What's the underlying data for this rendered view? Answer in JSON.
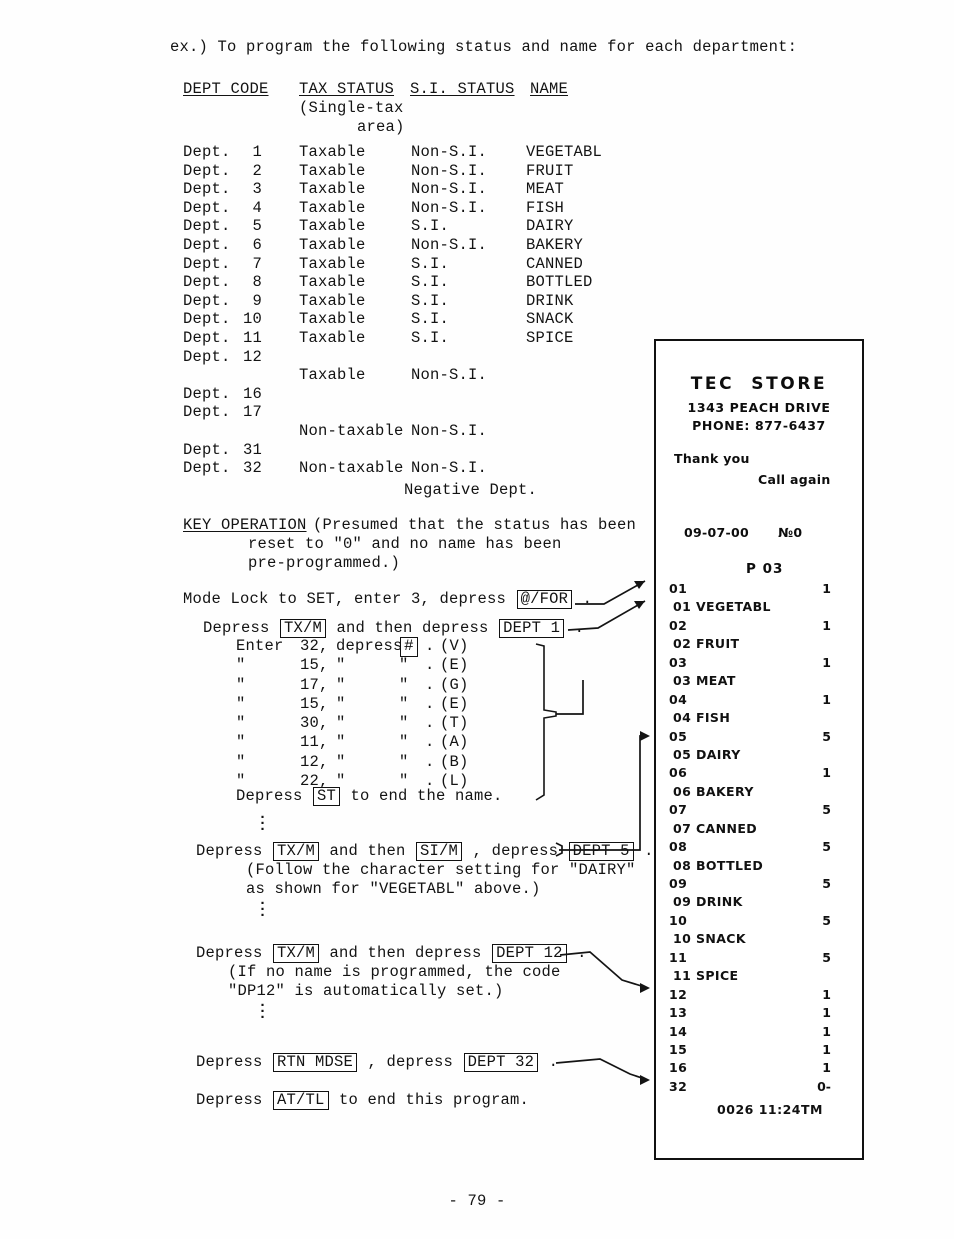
{
  "intro": "ex.) To program the following status and name for each department:",
  "table": {
    "headers": {
      "dept_code": "DEPT CODE",
      "tax_status": "TAX STATUS",
      "si_status": "S.I. STATUS",
      "name": "NAME",
      "tax_sub_1": "(Single-tax",
      "tax_sub_2": "area)"
    },
    "rows": [
      {
        "code_label": "Dept.",
        "code_num": "1",
        "tax": "Taxable",
        "si": "Non-S.I.",
        "name": "VEGETABL"
      },
      {
        "code_label": "Dept.",
        "code_num": "2",
        "tax": "Taxable",
        "si": "Non-S.I.",
        "name": "FRUIT"
      },
      {
        "code_label": "Dept.",
        "code_num": "3",
        "tax": "Taxable",
        "si": "Non-S.I.",
        "name": "MEAT"
      },
      {
        "code_label": "Dept.",
        "code_num": "4",
        "tax": "Taxable",
        "si": "Non-S.I.",
        "name": "FISH"
      },
      {
        "code_label": "Dept.",
        "code_num": "5",
        "tax": "Taxable",
        "si": "S.I.",
        "name": "DAIRY"
      },
      {
        "code_label": "Dept.",
        "code_num": "6",
        "tax": "Taxable",
        "si": "Non-S.I.",
        "name": "BAKERY"
      },
      {
        "code_label": "Dept.",
        "code_num": "7",
        "tax": "Taxable",
        "si": "S.I.",
        "name": "CANNED"
      },
      {
        "code_label": "Dept.",
        "code_num": "8",
        "tax": "Taxable",
        "si": "S.I.",
        "name": "BOTTLED"
      },
      {
        "code_label": "Dept.",
        "code_num": "9",
        "tax": "Taxable",
        "si": "S.I.",
        "name": "DRINK"
      },
      {
        "code_label": "Dept.",
        "code_num": "10",
        "tax": "Taxable",
        "si": "S.I.",
        "name": "SNACK"
      },
      {
        "code_label": "Dept.",
        "code_num": "11",
        "tax": "Taxable",
        "si": "S.I.",
        "name": "SPICE"
      },
      {
        "code_label": "Dept.",
        "code_num": "12",
        "tax": "",
        "si": "",
        "name": ""
      },
      {
        "code_label": "",
        "code_num": "",
        "tax": "Taxable",
        "si": "Non-S.I.",
        "name": ""
      },
      {
        "code_label": "Dept.",
        "code_num": "16",
        "tax": "",
        "si": "",
        "name": ""
      },
      {
        "code_label": "Dept.",
        "code_num": "17",
        "tax": "",
        "si": "",
        "name": ""
      },
      {
        "code_label": "",
        "code_num": "",
        "tax": "Non-taxable",
        "si": "Non-S.I.",
        "name": ""
      },
      {
        "code_label": "Dept.",
        "code_num": "31",
        "tax": "",
        "si": "",
        "name": ""
      },
      {
        "code_label": "Dept.",
        "code_num": "32",
        "tax": "Non-taxable",
        "si": "Non-S.I.",
        "name": ""
      }
    ],
    "negative_dept": "Negative Dept."
  },
  "key_operation": {
    "title": "KEY OPERATION",
    "note_line1": "(Presumed that the status has been",
    "note_line2": "reset to \"0\" and no name has been",
    "note_line3": "pre-programmed.)",
    "mode_lock": {
      "pre": "Mode Lock to SET, enter 3, depress ",
      "key": "@/FOR",
      "post": " ."
    },
    "dept1": {
      "pre": "Depress ",
      "key1": "TX/M",
      "mid": " and then depress ",
      "key2": "DEPT 1",
      "post": " ."
    },
    "char_entry": [
      {
        "lead": "Enter",
        "num": "32,",
        "c2": "depress",
        "ditto": "#",
        "dot": ".",
        "ch": "(V)",
        "key": true
      },
      {
        "lead": "\"",
        "num": "15,",
        "c2": "\"",
        "ditto": "\"",
        "dot": ".",
        "ch": "(E)",
        "key": false
      },
      {
        "lead": "\"",
        "num": "17,",
        "c2": "\"",
        "ditto": "\"",
        "dot": ".",
        "ch": "(G)",
        "key": false
      },
      {
        "lead": "\"",
        "num": "15,",
        "c2": "\"",
        "ditto": "\"",
        "dot": ".",
        "ch": "(E)",
        "key": false
      },
      {
        "lead": "\"",
        "num": "30,",
        "c2": "\"",
        "ditto": "\"",
        "dot": ".",
        "ch": "(T)",
        "key": false
      },
      {
        "lead": "\"",
        "num": "11,",
        "c2": "\"",
        "ditto": "\"",
        "dot": ".",
        "ch": "(A)",
        "key": false
      },
      {
        "lead": "\"",
        "num": "12,",
        "c2": "\"",
        "ditto": "\"",
        "dot": ".",
        "ch": "(B)",
        "key": false
      },
      {
        "lead": "\"",
        "num": "22,",
        "c2": "\"",
        "ditto": "\"",
        "dot": ".",
        "ch": "(L)",
        "key": false
      }
    ],
    "st_line": {
      "pre": "Depress ",
      "key": "ST",
      "post": " to end the name."
    },
    "dept5": {
      "pre": "Depress ",
      "key1": "TX/M",
      "mid": " and then ",
      "key2": "SI/M",
      "mid2": " , depress ",
      "key3": "DEPT 5",
      "post": " .",
      "note1": "(Follow the character setting for \"DAIRY\"",
      "note2": "as shown for \"VEGETABL\" above.)"
    },
    "dept12": {
      "pre": "Depress ",
      "key1": "TX/M",
      "mid": " and then depress ",
      "key2": "DEPT 12",
      "post": " .",
      "note1": "(If no name is programmed, the code",
      "note2": "\"DP12\" is automatically set.)"
    },
    "dept32": {
      "pre": "Depress ",
      "key1": "RTN MDSE",
      "mid": " , depress ",
      "key2": "DEPT 32",
      "post": " ."
    },
    "attl": {
      "pre": "Depress ",
      "key1": "AT/TL",
      "post": " to end this program."
    }
  },
  "receipt": {
    "store": "TEC  STORE",
    "address": "1343 PEACH DRIVE",
    "phone": "PHONE: 877-6437",
    "thanks": "Thank you",
    "call_again": "Call again",
    "date": "09-07-00",
    "register_no": "№0",
    "program_label": "P 03",
    "rows": [
      {
        "code": "01",
        "name": "",
        "qty": "1",
        "indent": false
      },
      {
        "code": "01 VEGETABL",
        "name": "",
        "qty": "",
        "indent": true
      },
      {
        "code": "02",
        "name": "",
        "qty": "1",
        "indent": false
      },
      {
        "code": "02 FRUIT",
        "name": "",
        "qty": "",
        "indent": true
      },
      {
        "code": "03",
        "name": "",
        "qty": "1",
        "indent": false
      },
      {
        "code": "03 MEAT",
        "name": "",
        "qty": "",
        "indent": true
      },
      {
        "code": "04",
        "name": "",
        "qty": "1",
        "indent": false
      },
      {
        "code": "04 FISH",
        "name": "",
        "qty": "",
        "indent": true
      },
      {
        "code": "05",
        "name": "",
        "qty": "5",
        "indent": false
      },
      {
        "code": "05 DAIRY",
        "name": "",
        "qty": "",
        "indent": true
      },
      {
        "code": "06",
        "name": "",
        "qty": "1",
        "indent": false
      },
      {
        "code": "06 BAKERY",
        "name": "",
        "qty": "",
        "indent": true
      },
      {
        "code": "07",
        "name": "",
        "qty": "5",
        "indent": false
      },
      {
        "code": "07 CANNED",
        "name": "",
        "qty": "",
        "indent": true
      },
      {
        "code": "08",
        "name": "",
        "qty": "5",
        "indent": false
      },
      {
        "code": "08 BOTTLED",
        "name": "",
        "qty": "",
        "indent": true
      },
      {
        "code": "09",
        "name": "",
        "qty": "5",
        "indent": false
      },
      {
        "code": "09 DRINK",
        "name": "",
        "qty": "",
        "indent": true
      },
      {
        "code": "10",
        "name": "",
        "qty": "5",
        "indent": false
      },
      {
        "code": "10 SNACK",
        "name": "",
        "qty": "",
        "indent": true
      },
      {
        "code": "11",
        "name": "",
        "qty": "5",
        "indent": false
      },
      {
        "code": "11 SPICE",
        "name": "",
        "qty": "",
        "indent": true
      },
      {
        "code": "12",
        "name": "",
        "qty": "1",
        "indent": false
      },
      {
        "code": "13",
        "name": "",
        "qty": "1",
        "indent": false
      },
      {
        "code": "14",
        "name": "",
        "qty": "1",
        "indent": false
      },
      {
        "code": "15",
        "name": "",
        "qty": "1",
        "indent": false
      },
      {
        "code": "16",
        "name": "",
        "qty": "1",
        "indent": false
      },
      {
        "code": "32",
        "name": "",
        "qty": "0-",
        "indent": false
      }
    ],
    "footer": "0026 11:24TM"
  },
  "page_number": "- 79 -"
}
